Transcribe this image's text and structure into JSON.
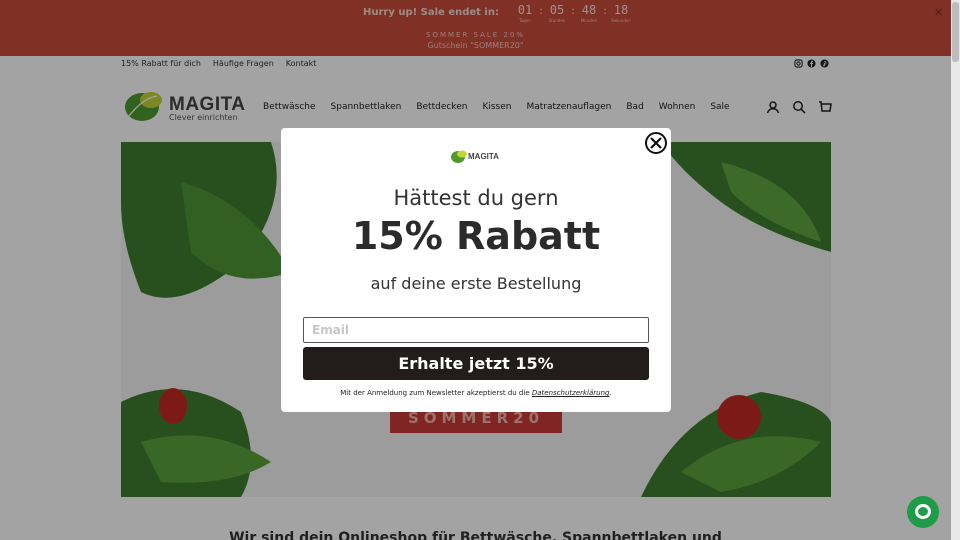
{
  "promo": {
    "hurry_text": "Hurry up! Sale endet in:",
    "countdown": [
      {
        "value": "01",
        "label": "Tagen"
      },
      {
        "value": "05",
        "label": "Stunden"
      },
      {
        "value": "48",
        "label": "Minuten"
      },
      {
        "value": "18",
        "label": "Sekunden"
      }
    ],
    "line1": "SOMMER SALE 20%",
    "line2": "Gutschein \"SOMMER20\"",
    "close_label": "✕",
    "bg_color": "#c94b3b"
  },
  "utility_links": [
    "15% Rabatt für dich",
    "Häufige Fragen",
    "Kontakt"
  ],
  "socials": [
    "instagram-icon",
    "facebook-icon",
    "pinterest-icon"
  ],
  "header": {
    "logo_text": "MAGITA",
    "logo_sub": "Clever einrichten",
    "nav": [
      "Bettwäsche",
      "Spannbettlaken",
      "Bettdecken",
      "Kissen",
      "Matratzenauflagen",
      "Bad",
      "Wohnen",
      "Sale"
    ],
    "icons": [
      "account-icon",
      "search-icon",
      "cart-icon"
    ]
  },
  "hero": {
    "code_text": "SOMMER20"
  },
  "bottom_heading": "Wir sind dein Onlineshop für Bettwäsche, Spannbettlaken und",
  "modal": {
    "logo_text": "MAGITA",
    "title": "Hättest du gern",
    "big": "15% Rabatt",
    "sub": "auf deine erste Bestellung",
    "email_placeholder": "Email",
    "cta": "Erhalte jetzt 15%",
    "consent_prefix": "Mit der Anmeldung zum Newsletter akzeptierst du die ",
    "consent_link": "Datenschutzerklärung",
    "consent_suffix": "."
  },
  "colors": {
    "accent_green": "#5aa83a",
    "cta_dark": "#221c1c",
    "chat_green": "#1f9b49"
  }
}
